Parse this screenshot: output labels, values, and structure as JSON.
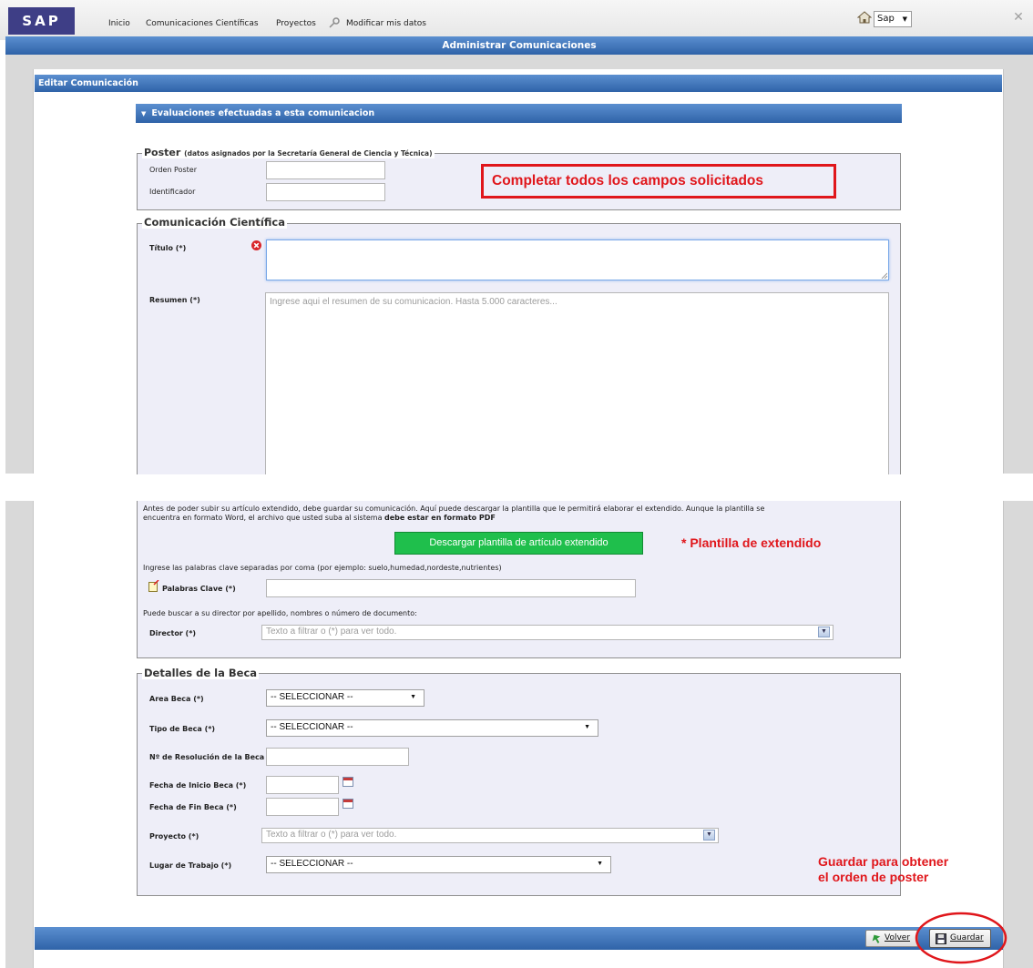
{
  "app": {
    "logo": "SAP",
    "page_title": "Administrar Comunicaciones"
  },
  "nav": {
    "items": [
      "Inicio",
      "Comunicaciones Científicas",
      "Proyectos",
      "Modificar mis datos"
    ],
    "user": "Sap"
  },
  "editor": {
    "title": "Editar Comunicación",
    "evaluations": "Evaluaciones efectuadas a esta comunicacion",
    "poster": {
      "legend": "Poster",
      "legend_note": "(datos asignados por la Secretaría General de Ciencia y Técnica)",
      "orden_label": "Orden Poster",
      "ident_label": "Identificador"
    },
    "comunicacion": {
      "legend": "Comunicación Científica",
      "titulo_label": "Título (*)",
      "resumen_label": "Resumen (*)",
      "resumen_placeholder": "Ingrese aqui el resumen de su comunicacion. Hasta 5.000 caracteres...",
      "info_line1": "Antes de poder subir su artículo extendido, debe guardar su comunicación. Aquí puede descargar la plantilla que le permitirá elaborar el extendido. Aunque la plantilla se",
      "info_line2": "encuentra en formato Word, el archivo que usted suba al sistema",
      "info_bold": "debe estar en formato PDF",
      "download_button": "Descargar plantilla de artículo extendido",
      "keywords_hint": "Ingrese las palabras clave separadas por coma (por ejemplo: suelo,humedad,nordeste,nutrientes)",
      "keywords_label": "Palabras Clave (*)",
      "director_hint": "Puede buscar a su director por apellido, nombres o número de documento:",
      "director_label": "Director (*)",
      "director_placeholder": "Texto a filtrar o (*) para ver todo."
    },
    "beca": {
      "legend": "Detalles de la Beca",
      "area_label": "Area Beca (*)",
      "area_value": "-- SELECCIONAR --",
      "tipo_label": "Tipo de Beca (*)",
      "tipo_value": "-- SELECCIONAR --",
      "resolucion_label": "Nº de Resolución de la Beca",
      "inicio_label": "Fecha de Inicio Beca (*)",
      "fin_label": "Fecha de Fin Beca (*)",
      "proyecto_label": "Proyecto (*)",
      "proyecto_placeholder": "Texto a filtrar o (*) para ver todo.",
      "lugar_label": "Lugar de Trabajo (*)",
      "lugar_value": "-- SELECCIONAR --"
    },
    "actions": {
      "volver": "Volver",
      "guardar": "Guardar"
    }
  },
  "annotations": {
    "completar": "Completar todos los campos solicitados",
    "plantilla": "* Plantilla de extendido",
    "guardar_line1": "Guardar para obtener",
    "guardar_line2": "el orden de poster"
  },
  "colors": {
    "accent_blue": "#3a6fb5",
    "annotation_red": "#e0161b",
    "download_green": "#1fbf4c"
  }
}
